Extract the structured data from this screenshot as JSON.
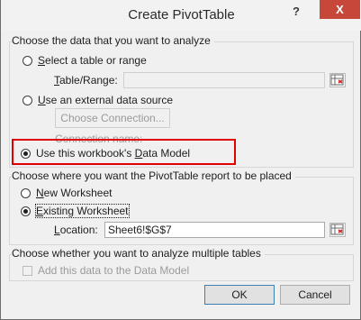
{
  "window": {
    "title": "Create PivotTable",
    "help_glyph": "?",
    "close_glyph": "X"
  },
  "section1": {
    "title": "Choose the data that you want to analyze",
    "opt_table_prefix": "S",
    "opt_table_rest": "elect a table or range",
    "table_range_prefix": "T",
    "table_range_rest": "able/Range:",
    "table_range_value": "",
    "opt_external_prefix": "U",
    "opt_external_rest": "se an external data source",
    "choose_connection_label": "Choose Connection...",
    "connection_name_label": "Connection name:",
    "opt_datamodel_a": "Use this workbook's ",
    "opt_datamodel_u": "D",
    "opt_datamodel_b": "ata Model"
  },
  "section2": {
    "title": "Choose where you want the PivotTable report to be placed",
    "opt_new_prefix": "N",
    "opt_new_rest": "ew Worksheet",
    "opt_existing_prefix": "E",
    "opt_existing_rest": "xisting Worksheet",
    "location_prefix": "L",
    "location_rest": "ocation:",
    "location_value": "Sheet6!$G$7"
  },
  "section3": {
    "title": "Choose whether you want to analyze multiple tables",
    "add_datamodel_label": "Add this data to the Data Model"
  },
  "buttons": {
    "ok": "OK",
    "cancel": "Cancel"
  },
  "colors": {
    "highlight": "#e00000",
    "close_button": "#c7483a"
  }
}
